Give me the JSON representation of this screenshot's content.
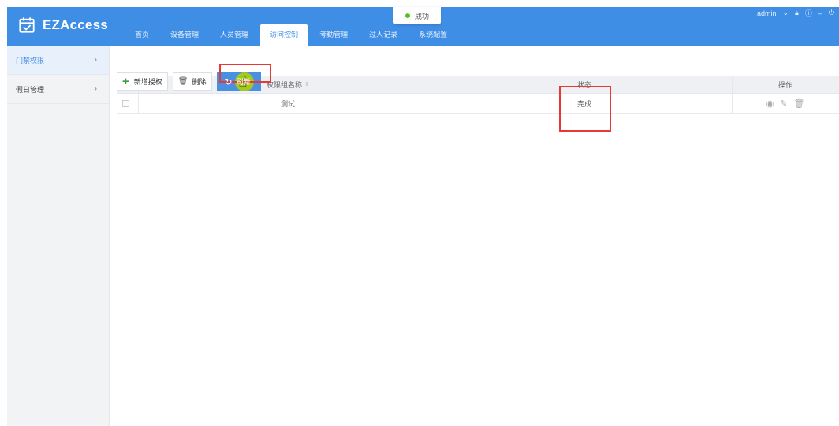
{
  "app": {
    "name": "EZAccess"
  },
  "header": {
    "nav": [
      {
        "label": "首页",
        "active": false
      },
      {
        "label": "设备管理",
        "active": false
      },
      {
        "label": "人员管理",
        "active": false
      },
      {
        "label": "访问控制",
        "active": true
      },
      {
        "label": "考勤管理",
        "active": false
      },
      {
        "label": "过人记录",
        "active": false
      },
      {
        "label": "系统配置",
        "active": false
      }
    ],
    "user": "admin"
  },
  "toast": {
    "text": "成功",
    "status_color": "#52c41a"
  },
  "sidebar": {
    "items": [
      {
        "label": "门禁权限",
        "active": true
      },
      {
        "label": "假日管理",
        "active": false
      }
    ]
  },
  "toolbar": {
    "add_label": "新增授权",
    "delete_label": "删除",
    "refresh_label": "刷新"
  },
  "table": {
    "columns": {
      "name": "权限组名称",
      "status": "状态",
      "actions": "操作"
    },
    "rows": [
      {
        "name": "测试",
        "status": "完成"
      }
    ]
  },
  "colors": {
    "primary": "#3f8ee6",
    "highlight_box": "#e53935"
  }
}
